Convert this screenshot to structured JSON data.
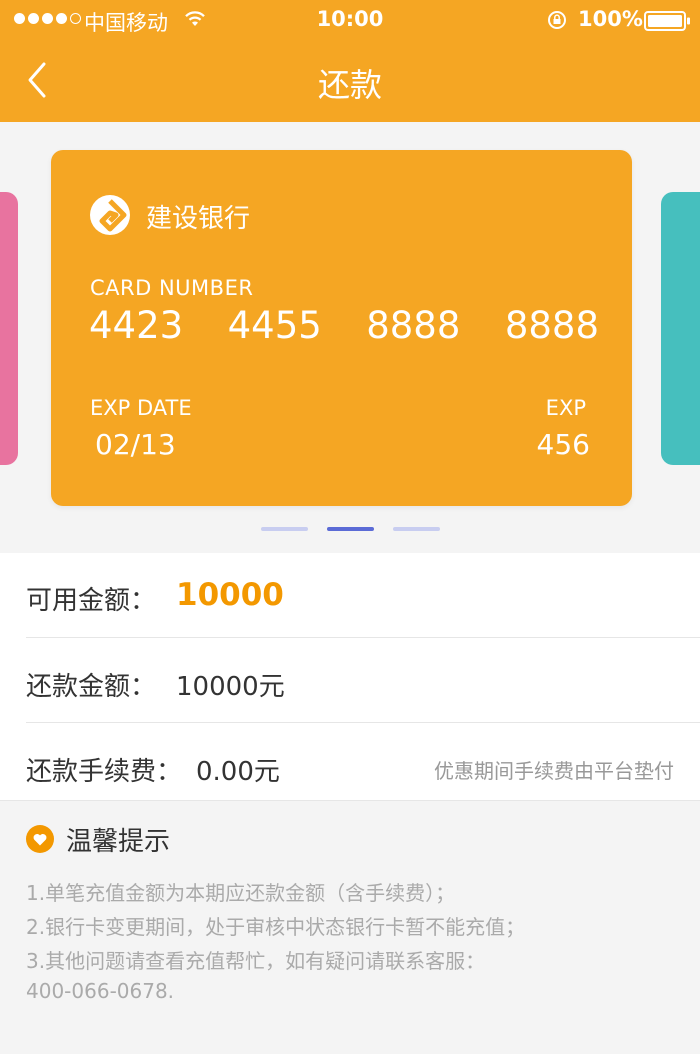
{
  "status_bar": {
    "carrier": "中国移动",
    "time": "10:00",
    "battery": "100%"
  },
  "nav": {
    "title": "还款",
    "back_icon": "chevron-left-icon"
  },
  "card": {
    "bank_name": "建设银行",
    "card_number_label": "CARD NUMBER",
    "card_number": [
      "4423",
      "4455",
      "8888",
      "8888"
    ],
    "exp_date_label": "EXP DATE",
    "exp_date": "02/13",
    "exp_label": "EXP",
    "exp_value": "456",
    "color": "#f5a623"
  },
  "carousel": {
    "side_colors": [
      "#e8739f",
      "#46bfbe"
    ],
    "active_index": 1,
    "count": 3
  },
  "info": {
    "available_label": "可用金额：",
    "available_value": "10000",
    "repay_label": "还款金额：",
    "repay_value": "10000元",
    "fee_label": "还款手续费：",
    "fee_value": "0.00元",
    "fee_note": "优惠期间手续费由平台垫付"
  },
  "tips": {
    "icon": "heart-icon",
    "title": "温馨提示",
    "lines": [
      "1.单笔充值金额为本期应还款金额（含手续费）；",
      "2.银行卡变更期间，处于审核中状态银行卡暂不能充值；",
      "3.其他问题请查看充值帮忙，如有疑问请联系客服：",
      "400-066-0678."
    ]
  },
  "colors": {
    "brand": "#f5a623",
    "accent_value": "#f39800",
    "indicator_active": "#5b6bd6",
    "indicator_inactive": "#c8cdf0"
  }
}
